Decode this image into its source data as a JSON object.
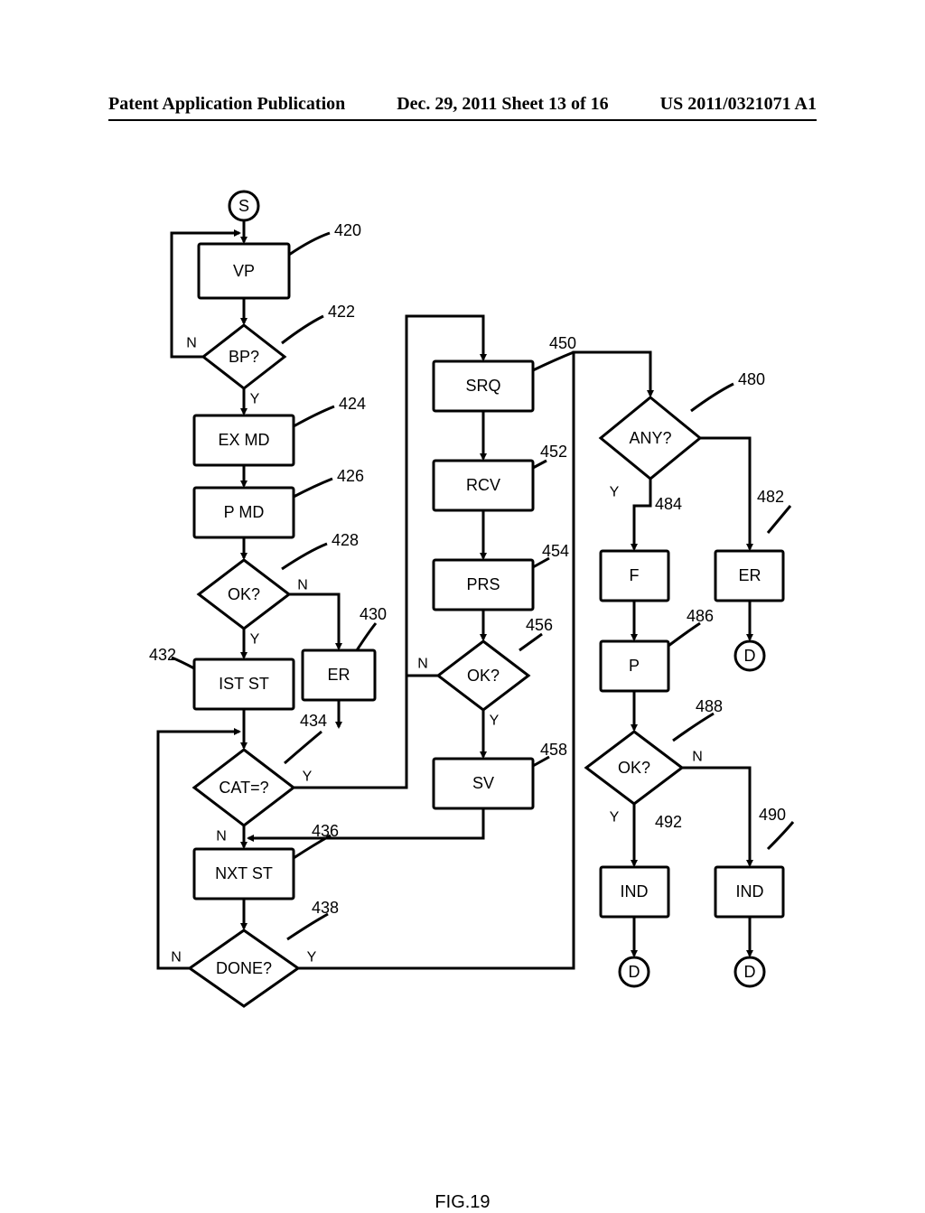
{
  "header": {
    "left": "Patent Application Publication",
    "center": "Dec. 29, 2011  Sheet 13 of 16",
    "right": "US 2011/0321071 A1"
  },
  "figure_caption": "FIG.19",
  "nodes": {
    "S": "S",
    "VP": "VP",
    "BP": "BP?",
    "EXMD": "EX MD",
    "PMD": "P MD",
    "OK1": "OK?",
    "ER1": "ER",
    "ISTST": "IST ST",
    "CAT": "CAT=?",
    "NXTST": "NXT ST",
    "DONE": "DONE?",
    "SRQ": "SRQ",
    "RCV": "RCV",
    "PRS": "PRS",
    "OK2": "OK?",
    "SV": "SV",
    "ANY": "ANY?",
    "F": "F",
    "ER2": "ER",
    "P": "P",
    "D1": "D",
    "OK3": "OK?",
    "IND1": "IND",
    "IND2": "IND",
    "D2": "D",
    "D3": "D"
  },
  "labels": {
    "Y": "Y",
    "N": "N"
  },
  "refs": {
    "r420": "420",
    "r422": "422",
    "r424": "424",
    "r426": "426",
    "r428": "428",
    "r430": "430",
    "r432": "432",
    "r434": "434",
    "r436": "436",
    "r438": "438",
    "r450": "450",
    "r452": "452",
    "r454": "454",
    "r456": "456",
    "r458": "458",
    "r480": "480",
    "r482": "482",
    "r484": "484",
    "r486": "486",
    "r488": "488",
    "r490": "490",
    "r492": "492"
  }
}
